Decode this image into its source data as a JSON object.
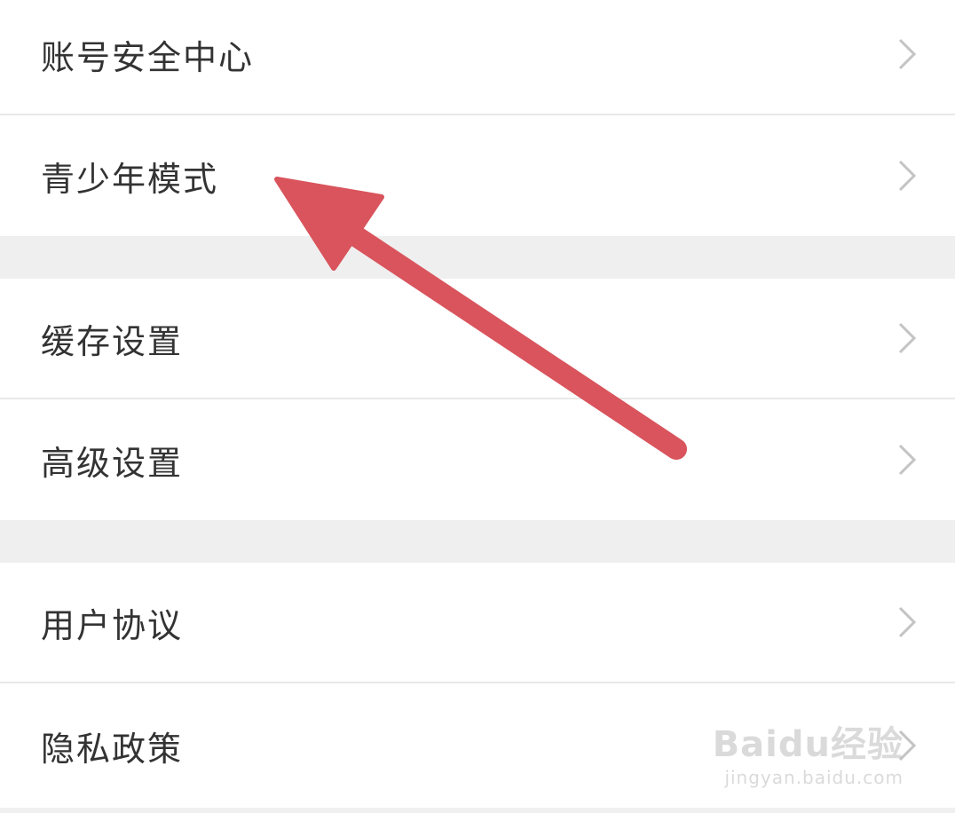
{
  "settings": {
    "groups": [
      {
        "items": [
          {
            "label": "账号安全中心"
          },
          {
            "label": "青少年模式"
          }
        ]
      },
      {
        "items": [
          {
            "label": "缓存设置"
          },
          {
            "label": "高级设置"
          }
        ]
      },
      {
        "items": [
          {
            "label": "用户协议"
          },
          {
            "label": "隐私政策"
          }
        ]
      }
    ]
  },
  "annotation": {
    "color": "#d9545c"
  },
  "watermark": {
    "logo": "Baidu经验",
    "url": "jingyan.baidu.com"
  }
}
